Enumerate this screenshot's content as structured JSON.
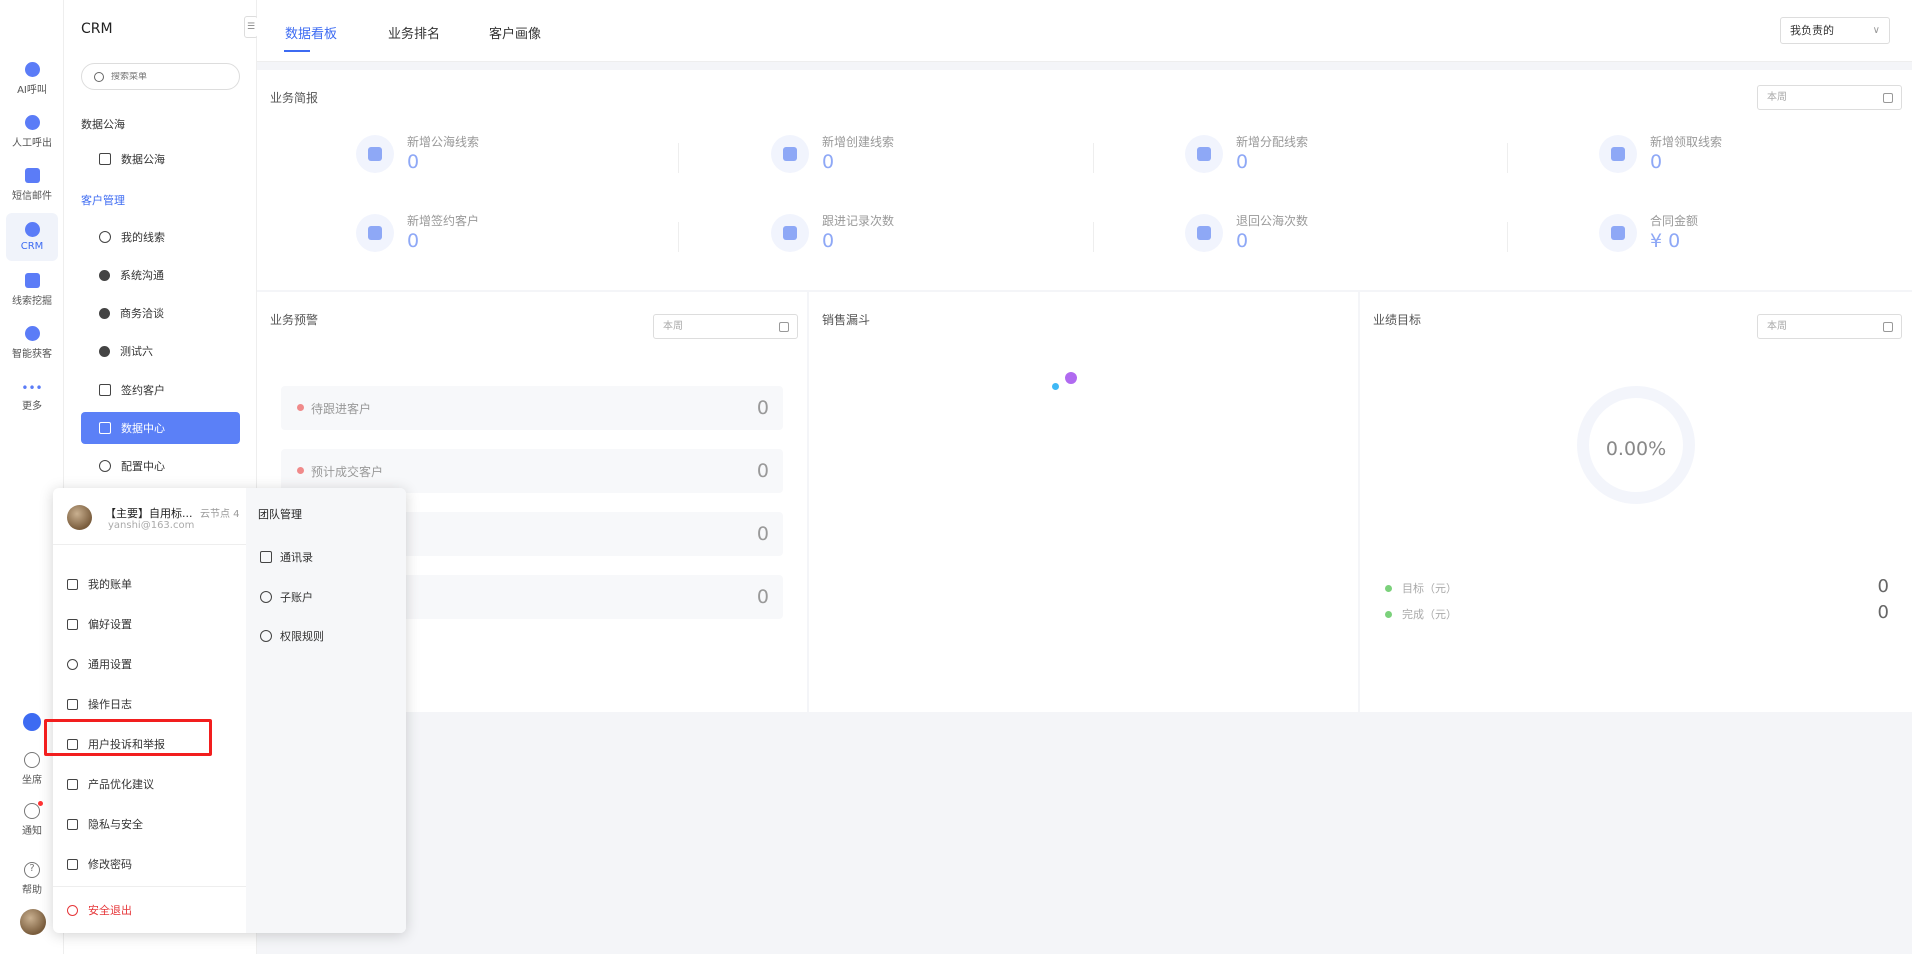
{
  "rail": {
    "items": [
      {
        "label": "AI呼叫"
      },
      {
        "label": "人工呼出"
      },
      {
        "label": "短信邮件"
      },
      {
        "label": "CRM"
      },
      {
        "label": "线索挖掘"
      },
      {
        "label": "智能获客"
      },
      {
        "label": "更多"
      }
    ],
    "bottom": {
      "seat": "坐席",
      "notify": "通知",
      "help": "帮助",
      "help_glyph": "?"
    }
  },
  "menu": {
    "title": "CRM",
    "collapse_glyph": "☰",
    "search_placeholder": "搜索菜单",
    "group1": "数据公海",
    "group1_items": [
      {
        "label": "数据公海"
      }
    ],
    "group2": "客户管理",
    "group2_items": [
      {
        "label": "我的线索"
      },
      {
        "label": "系统沟通"
      },
      {
        "label": "商务洽谈"
      },
      {
        "label": "测试六"
      },
      {
        "label": "签约客户"
      },
      {
        "label": "数据中心"
      },
      {
        "label": "配置中心"
      }
    ]
  },
  "tabs": [
    {
      "label": "数据看板"
    },
    {
      "label": "业务排名"
    },
    {
      "label": "客户画像"
    }
  ],
  "scope_select": {
    "value": "我负责的",
    "chevron": "∨"
  },
  "overview": {
    "title": "业务简报",
    "date": "本周",
    "stats": [
      {
        "label": "新增公海线索",
        "value": "0"
      },
      {
        "label": "新增创建线索",
        "value": "0"
      },
      {
        "label": "新增分配线索",
        "value": "0"
      },
      {
        "label": "新增领取线索",
        "value": "0"
      },
      {
        "label": "新增签约客户",
        "value": "0"
      },
      {
        "label": "跟进记录次数",
        "value": "0"
      },
      {
        "label": "退回公海次数",
        "value": "0"
      },
      {
        "label": "合同金额",
        "value": "¥ 0"
      }
    ]
  },
  "warning": {
    "title": "业务预警",
    "date": "本周",
    "rows": [
      {
        "label": "待跟进客户",
        "value": "0"
      },
      {
        "label": "预计成交客户",
        "value": "0"
      },
      {
        "label": "",
        "value": "0"
      },
      {
        "label": "",
        "value": "0"
      }
    ]
  },
  "funnel": {
    "title": "销售漏斗"
  },
  "target": {
    "title": "业绩目标",
    "date": "本周",
    "percent": "0.00%",
    "legend": [
      {
        "label": "目标（元）",
        "value": "0"
      },
      {
        "label": "完成（元）",
        "value": "0"
      }
    ]
  },
  "user_popup": {
    "name": "【主要】自用标...",
    "node": "云节点 4",
    "email": "yanshi@163.com",
    "items": [
      {
        "label": "我的账单"
      },
      {
        "label": "偏好设置"
      },
      {
        "label": "通用设置"
      },
      {
        "label": "操作日志"
      },
      {
        "label": "用户投诉和举报"
      },
      {
        "label": "产品优化建议"
      },
      {
        "label": "隐私与安全"
      },
      {
        "label": "修改密码"
      }
    ],
    "logout": "安全退出",
    "team_title": "团队管理",
    "team_items": [
      {
        "label": "通讯录"
      },
      {
        "label": "子账户"
      },
      {
        "label": "权限规则"
      }
    ]
  },
  "colors": {
    "accent": "#3d6bf2",
    "menu_active": "#5b80f7",
    "stat_value": "#8ea8f6",
    "highlight_box": "#f21e1e",
    "logout": "#e6373a"
  }
}
